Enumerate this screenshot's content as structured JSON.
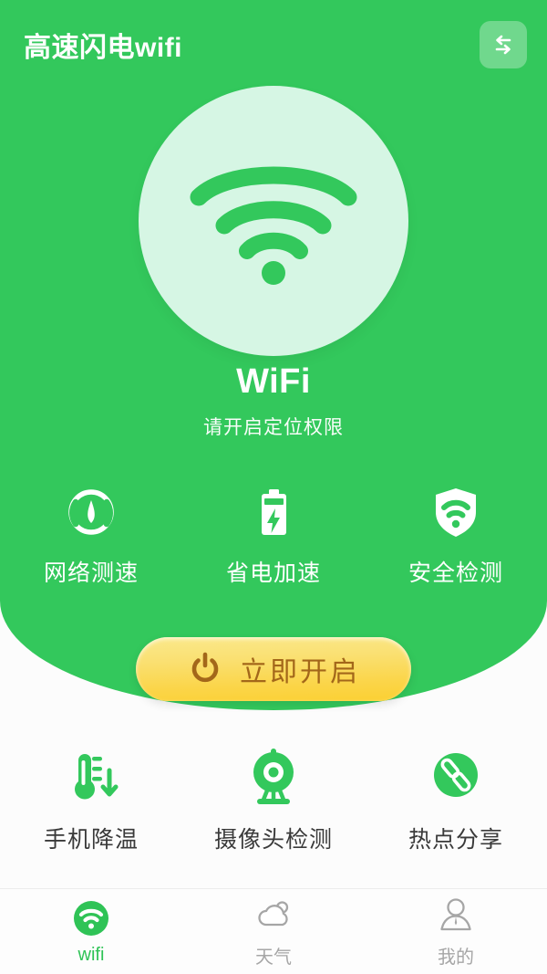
{
  "theme": {
    "brand_green": "#33c85c",
    "disc_mint": "#d6f6e4",
    "cta_yellow": "#fbd549",
    "cta_text_brown": "#a3671a",
    "tab_active": "#2fc356",
    "tab_inactive": "#a6a6a6"
  },
  "header": {
    "title": "高速闪电wifi",
    "swap_icon": "swap-arrows-icon"
  },
  "hero": {
    "wifi_icon": "wifi-signal-icon",
    "status_title": "WiFi",
    "status_subtitle": "请开启定位权限"
  },
  "features_top": [
    {
      "label": "网络测速",
      "icon": "speedometer-icon"
    },
    {
      "label": "省电加速",
      "icon": "battery-bolt-icon"
    },
    {
      "label": "安全检测",
      "icon": "shield-wifi-icon"
    }
  ],
  "cta": {
    "label": "立即开启",
    "icon": "power-icon"
  },
  "features_bottom": [
    {
      "label": "手机降温",
      "icon": "thermometer-down-icon"
    },
    {
      "label": "摄像头检测",
      "icon": "webcam-icon"
    },
    {
      "label": "热点分享",
      "icon": "link-share-icon"
    }
  ],
  "tabs": [
    {
      "label": "wifi",
      "icon": "wifi-tab-icon",
      "active": true
    },
    {
      "label": "天气",
      "icon": "cloud-sun-icon",
      "active": false
    },
    {
      "label": "我的",
      "icon": "person-icon",
      "active": false
    }
  ]
}
